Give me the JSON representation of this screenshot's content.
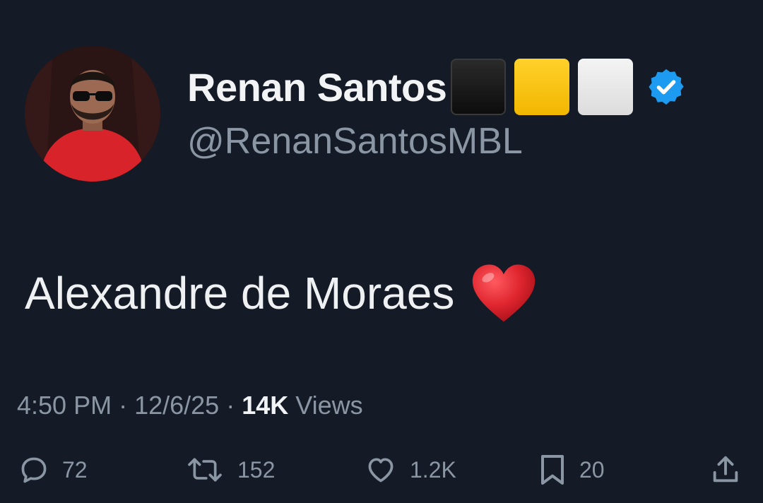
{
  "author": {
    "display_name": "Renan Santos",
    "handle": "@RenanSantosMBL",
    "name_emojis": [
      "black-square",
      "yellow-square",
      "white-square"
    ],
    "verified": true,
    "verified_color": "#1d9bf0"
  },
  "tweet": {
    "text": "Alexandre de Moraes",
    "emoji": "red-heart"
  },
  "meta": {
    "time": "4:50 PM",
    "separator": "·",
    "date": "12/6/25",
    "views_count": "14K",
    "views_label": "Views"
  },
  "actions": {
    "replies": "72",
    "reposts": "152",
    "likes": "1.2K",
    "bookmarks": "20"
  },
  "colors": {
    "background": "#141b27",
    "text_primary": "#e7e9ea",
    "text_secondary": "#8a96a3",
    "heart": "#e0262f"
  }
}
